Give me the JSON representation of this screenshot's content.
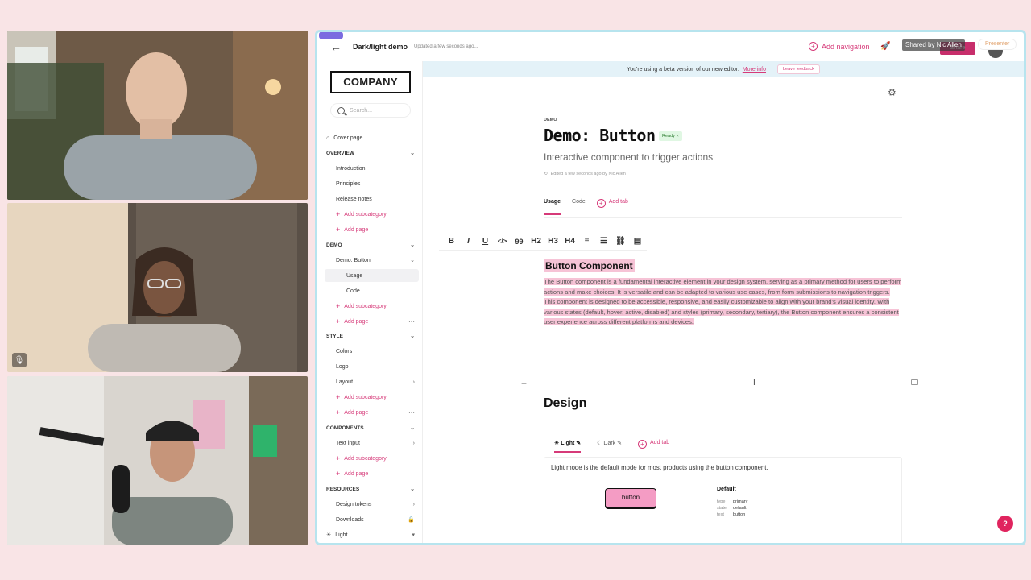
{
  "app": {
    "doc_title": "Dark/light demo",
    "updated": "Updated a few seconds ago...",
    "add_navigation": "Add navigation",
    "shared_by": "Shared by Nic Allen",
    "share_label": "Share",
    "presenter_label": "Presenter"
  },
  "banner": {
    "text": "You're using a beta version of our new editor.",
    "link": "More info",
    "feedback": "Leave feedback"
  },
  "sidebar": {
    "logo": "COMPANY",
    "search_placeholder": "Search...",
    "cover_page": "Cover page",
    "overview": "OVERVIEW",
    "introduction": "Introduction",
    "principles": "Principles",
    "release_notes": "Release notes",
    "add_subcategory": "Add subcategory",
    "add_page": "Add page",
    "demo": "DEMO",
    "demo_button": "Demo: Button",
    "usage": "Usage",
    "code": "Code",
    "style": "STYLE",
    "colors": "Colors",
    "logo_item": "Logo",
    "layout": "Layout",
    "components": "COMPONENTS",
    "text_input": "Text input",
    "resources": "RESOURCES",
    "design_tokens": "Design tokens",
    "downloads": "Downloads",
    "light": "Light"
  },
  "main": {
    "eyebrow": "DEMO",
    "title": "Demo: Button",
    "status": "Ready",
    "subtitle": "Interactive component to trigger actions",
    "edited": "Edited a few seconds ago by Nic Allen",
    "tabs": {
      "usage": "Usage",
      "code": "Code",
      "add": "Add tab"
    },
    "toolbar": {
      "bold": "B",
      "italic": "I",
      "underline": "U",
      "code": "</>",
      "quote": "99",
      "h2": "H2",
      "h3": "H3",
      "h4": "H4"
    },
    "component_heading": "Button Component",
    "paragraph": "The Button component is a fundamental interactive element in your design system, serving as a primary method for users to perform actions and make choices. It is versatile and can be adapted to various use cases, from form submissions to navigation triggers. This component is designed to be accessible, responsive, and easily customizable to align with your brand's visual identity. With various states (default, hover, active, disabled) and styles (primary, secondary, tertiary), the Button component ensures a consistent user experience across different platforms and devices.",
    "design_heading": "Design",
    "design_tabs": {
      "light": "Light",
      "dark": "Dark",
      "add": "Add tab"
    },
    "card_text": "Light mode is the default mode for most products using the button component.",
    "button_label": "button",
    "default_heading": "Default",
    "props": [
      {
        "k": "type",
        "v": "primary"
      },
      {
        "k": "state",
        "v": "default"
      },
      {
        "k": "text",
        "v": "button"
      }
    ],
    "help": "?"
  },
  "colors": {
    "accent": "#d63a79",
    "background": "#f9e4e6",
    "button_fill": "#f49cc4",
    "highlight": "#f6c3d6"
  }
}
